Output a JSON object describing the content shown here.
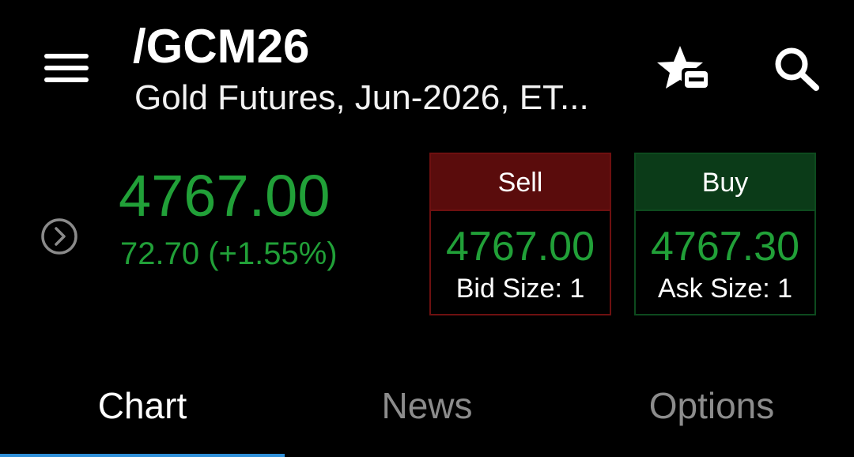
{
  "header": {
    "symbol": "/GCM26",
    "description": "Gold Futures, Jun-2026, ET..."
  },
  "icons": {
    "menu": "menu-icon",
    "watchlist": "star-minus-icon",
    "search": "search-icon",
    "expand": "chevron-right-circle-icon"
  },
  "quote": {
    "last_price": "4767.00",
    "change": "72.70 (+1.55%)"
  },
  "sell": {
    "label": "Sell",
    "price": "4767.00",
    "size": "Bid Size: 1"
  },
  "buy": {
    "label": "Buy",
    "price": "4767.30",
    "size": "Ask Size: 1"
  },
  "tabs": [
    {
      "label": "Chart",
      "selected": true
    },
    {
      "label": "News",
      "selected": false
    },
    {
      "label": "Options",
      "selected": false
    }
  ],
  "colors": {
    "positive": "#21a038",
    "sell_header": "#5a0c0c",
    "buy_header": "#0b3b18",
    "tab_indicator": "#2f8fd8"
  }
}
